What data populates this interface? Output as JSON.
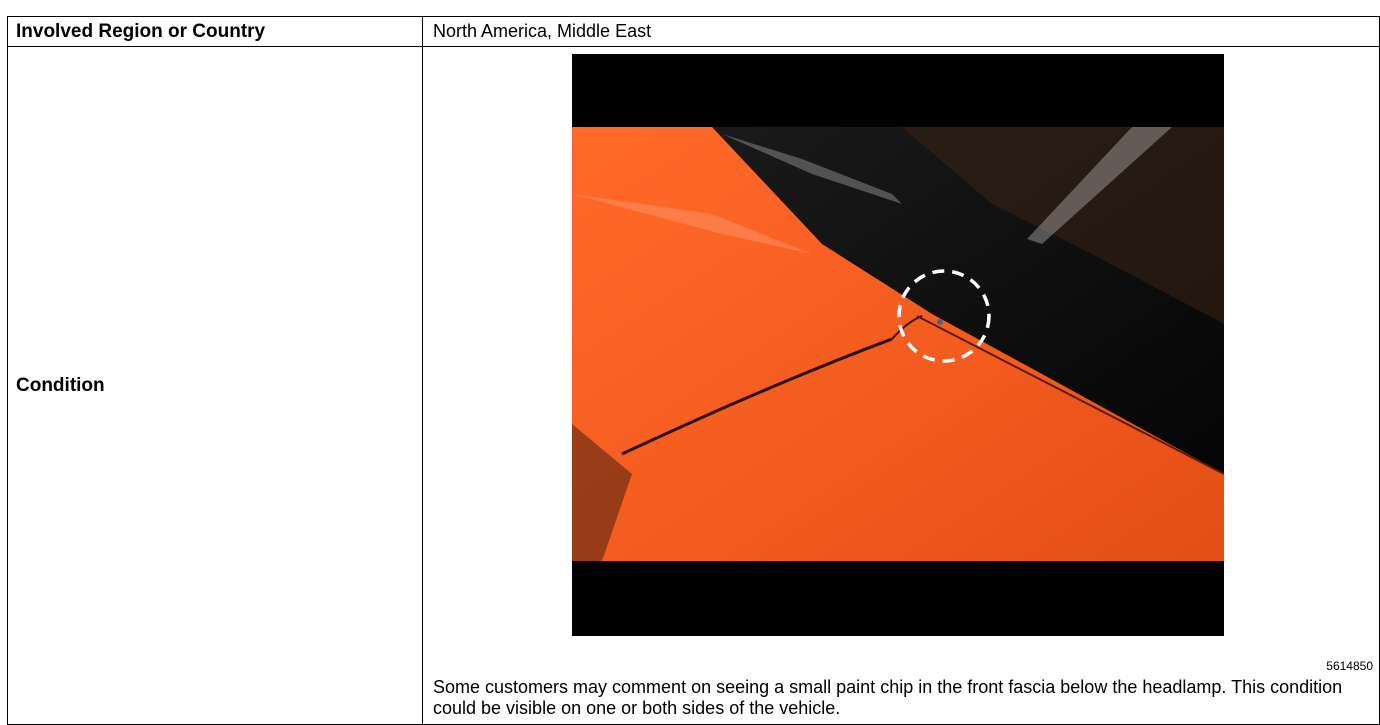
{
  "rows": [
    {
      "label": "Involved Region or Country",
      "value": "North America, Middle East"
    },
    {
      "label": "Condition"
    }
  ],
  "figure": {
    "image_id": "5614850",
    "caption": "Some customers may comment on seeing a small paint chip in the front fascia below the headlamp. This condition could be visible on one or both sides of the vehicle.",
    "colors": {
      "paint": "#f25a1e",
      "glass": "#0b0b0b",
      "circle": "#ffffff"
    }
  }
}
